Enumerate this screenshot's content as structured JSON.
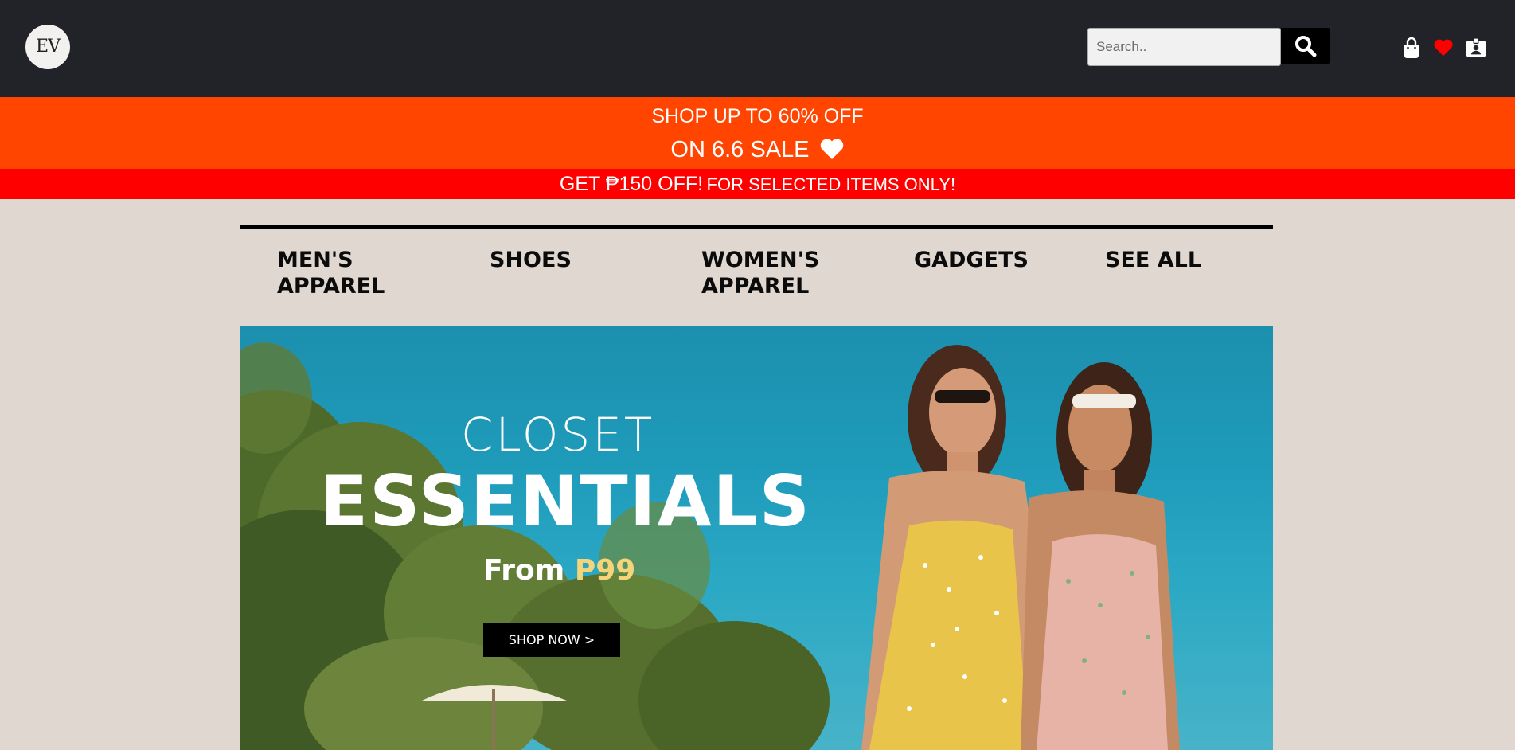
{
  "header": {
    "logo_text": "EV",
    "search_placeholder": "Search.."
  },
  "promo": {
    "line1": "SHOP UP TO 60% OFF",
    "line2": "ON 6.6 SALE",
    "strip_main": "GET ₱150 OFF!",
    "strip_sub": "FOR SELECTED ITEMS ONLY!"
  },
  "nav": {
    "items": [
      "MEN'S\nAPPAREL",
      "SHOES",
      "WOMEN'S\nAPPAREL",
      "GADGETS",
      "SEE ALL"
    ]
  },
  "banner": {
    "line1": "CLOSET",
    "line2": "ESSENTIALS",
    "from_label": "From",
    "price": "P99",
    "cta": "SHOP NOW >"
  },
  "colors": {
    "header_bg": "#212329",
    "promo_orange": "#ff4500",
    "promo_red": "#ff0000",
    "page_bg": "#e0d7d1",
    "heart_red": "#ff0000",
    "price_gold": "#f5d47a"
  },
  "icons": [
    "search-icon",
    "shopping-bag-icon",
    "heart-icon",
    "profile-badge-icon",
    "heart-outline-icon"
  ]
}
